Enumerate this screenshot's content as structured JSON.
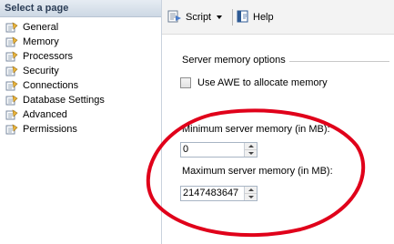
{
  "left_panel": {
    "header": "Select a page",
    "pages": [
      {
        "label": "General"
      },
      {
        "label": "Memory"
      },
      {
        "label": "Processors"
      },
      {
        "label": "Security"
      },
      {
        "label": "Connections"
      },
      {
        "label": "Database Settings"
      },
      {
        "label": "Advanced"
      },
      {
        "label": "Permissions"
      }
    ],
    "icon": "page-icon"
  },
  "toolbar": {
    "script_label": "Script",
    "script_icon": "script-icon",
    "help_label": "Help",
    "help_icon": "help-icon"
  },
  "memory": {
    "group_title": "Server memory options",
    "awe_label": "Use AWE to allocate memory",
    "awe_checked": false,
    "min_label": "Minimum server memory (in MB):",
    "min_value": "0",
    "max_label": "Maximum server memory (in MB):",
    "max_value": "2147483647"
  },
  "annotation_color": "#e0001a"
}
